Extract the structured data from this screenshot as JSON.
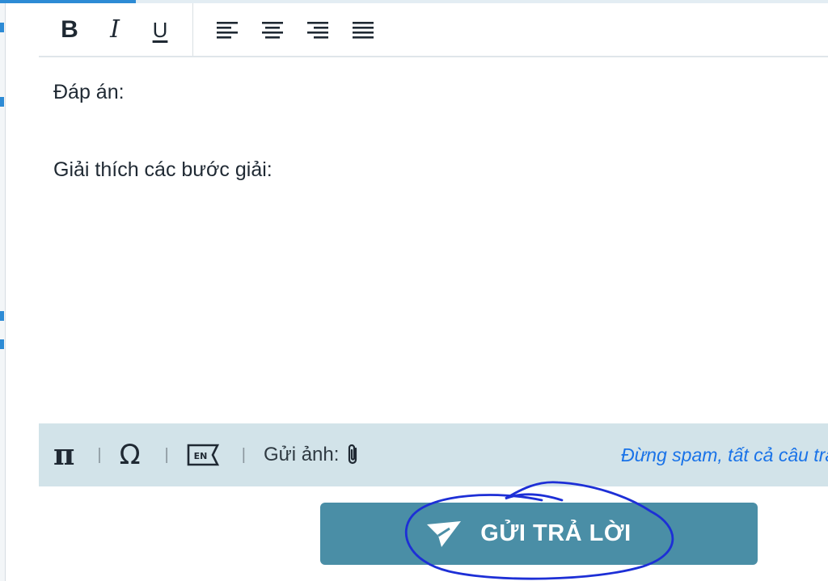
{
  "toolbar": {
    "bold": "B",
    "italic": "I",
    "underline": "U",
    "align_left": "align-left-icon",
    "align_center": "align-center-icon",
    "align_right": "align-right-icon",
    "align_justify": "align-justify-icon"
  },
  "editor": {
    "line1": "Đáp án:",
    "line2": "Giải thích các bước giải:"
  },
  "bottom_bar": {
    "math_symbol": "π",
    "special_char": "Ω",
    "keyboard_lang": "EN",
    "upload_label": "Gửi ảnh:",
    "notice": "Đừng spam, tất cả câu trả"
  },
  "submit": {
    "label": "GỬI TRẢ LỜI"
  },
  "colors": {
    "accent": "#4a8ea6",
    "bar": "#d2e3e9",
    "notice": "#1a73e8",
    "annotation": "#1d2fd6"
  }
}
